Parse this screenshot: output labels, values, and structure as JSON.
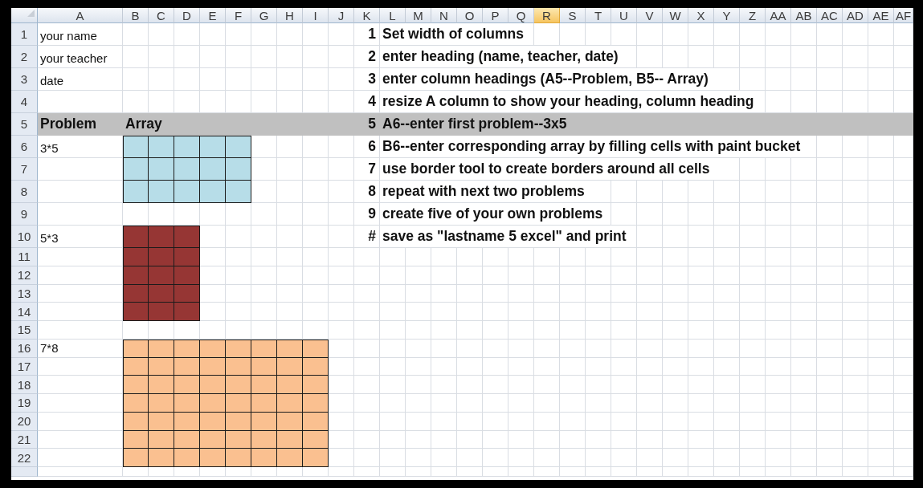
{
  "columns": [
    {
      "label": "A",
      "selected": false
    },
    {
      "label": "B",
      "selected": false
    },
    {
      "label": "C",
      "selected": false
    },
    {
      "label": "D",
      "selected": false
    },
    {
      "label": "E",
      "selected": false
    },
    {
      "label": "F",
      "selected": false
    },
    {
      "label": "G",
      "selected": false
    },
    {
      "label": "H",
      "selected": false
    },
    {
      "label": "I",
      "selected": false
    },
    {
      "label": "J",
      "selected": false
    },
    {
      "label": "K",
      "selected": false
    },
    {
      "label": "L",
      "selected": false
    },
    {
      "label": "M",
      "selected": false
    },
    {
      "label": "N",
      "selected": false
    },
    {
      "label": "O",
      "selected": false
    },
    {
      "label": "P",
      "selected": false
    },
    {
      "label": "Q",
      "selected": false
    },
    {
      "label": "R",
      "selected": true
    },
    {
      "label": "S",
      "selected": false
    },
    {
      "label": "T",
      "selected": false
    },
    {
      "label": "U",
      "selected": false
    },
    {
      "label": "V",
      "selected": false
    },
    {
      "label": "W",
      "selected": false
    },
    {
      "label": "X",
      "selected": false
    },
    {
      "label": "Y",
      "selected": false
    },
    {
      "label": "Z",
      "selected": false
    },
    {
      "label": "AA",
      "selected": false
    },
    {
      "label": "AB",
      "selected": false
    },
    {
      "label": "AC",
      "selected": false
    },
    {
      "label": "AD",
      "selected": false
    },
    {
      "label": "AE",
      "selected": false
    },
    {
      "label": "AF",
      "selected": false
    }
  ],
  "rows": [
    {
      "number": "1",
      "column_a": "your name",
      "column_k": "1",
      "column_l": "Set width of columns",
      "bold": false,
      "highlighted": false
    },
    {
      "number": "2",
      "column_a": "your teacher",
      "column_k": "2",
      "column_l": "enter heading (name, teacher, date)",
      "bold": false,
      "highlighted": false
    },
    {
      "number": "3",
      "column_a": "date",
      "column_k": "3",
      "column_l": "enter column headings (A5--Problem, B5-- Array)",
      "bold": false,
      "highlighted": false
    },
    {
      "number": "4",
      "column_k": "4",
      "column_l": "resize A column to show your heading, column heading",
      "highlighted": false
    },
    {
      "number": "5",
      "column_a": "Problem",
      "column_b": "Array",
      "column_k": "5",
      "column_l": "A6--enter first problem--3x5",
      "bold": true,
      "highlighted": true
    },
    {
      "number": "6",
      "column_a": "3*5",
      "column_k": "6",
      "column_l": "B6--enter corresponding array by filling cells with paint bucket",
      "bold": false,
      "highlighted": false,
      "fill": {
        "color": "#b7dde8",
        "cells": [
          true,
          true,
          true,
          true,
          true,
          false,
          false,
          false
        ]
      }
    },
    {
      "number": "7",
      "column_k": "7",
      "column_l": "use border tool to create borders around all cells",
      "highlighted": false,
      "fill": {
        "color": "#b7dde8",
        "cells": [
          true,
          true,
          true,
          true,
          true,
          false,
          false,
          false
        ]
      }
    },
    {
      "number": "8",
      "column_k": "8",
      "column_l": "repeat with next two problems",
      "highlighted": false,
      "fill": {
        "color": "#b7dde8",
        "cells": [
          true,
          true,
          true,
          true,
          true,
          false,
          false,
          false
        ]
      }
    },
    {
      "number": "9",
      "column_k": "9",
      "column_l": "create five of your own problems",
      "highlighted": false
    },
    {
      "number": "10",
      "column_a": "5*3",
      "column_k": "#",
      "column_l": "save as \"lastname 5 excel\" and print",
      "bold": false,
      "highlighted": false,
      "fill": {
        "color": "#963634",
        "cells": [
          true,
          true,
          true,
          false,
          false,
          false,
          false,
          false
        ]
      }
    },
    {
      "number": "11",
      "highlighted": false,
      "fill": {
        "color": "#963634",
        "cells": [
          true,
          true,
          true,
          false,
          false,
          false,
          false,
          false
        ]
      }
    },
    {
      "number": "12",
      "highlighted": false,
      "fill": {
        "color": "#963634",
        "cells": [
          true,
          true,
          true,
          false,
          false,
          false,
          false,
          false
        ]
      }
    },
    {
      "number": "13",
      "highlighted": false,
      "fill": {
        "color": "#963634",
        "cells": [
          true,
          true,
          true,
          false,
          false,
          false,
          false,
          false
        ]
      }
    },
    {
      "number": "14",
      "highlighted": false,
      "fill": {
        "color": "#963634",
        "cells": [
          true,
          true,
          true,
          false,
          false,
          false,
          false,
          false
        ]
      }
    },
    {
      "number": "15",
      "highlighted": false
    },
    {
      "number": "16",
      "column_a": "7*8",
      "bold": false,
      "highlighted": false,
      "fill": {
        "color": "#fac090",
        "cells": [
          true,
          true,
          true,
          true,
          true,
          true,
          true,
          true
        ]
      }
    },
    {
      "number": "17",
      "highlighted": false,
      "fill": {
        "color": "#fac090",
        "cells": [
          true,
          true,
          true,
          true,
          true,
          true,
          true,
          true
        ]
      }
    },
    {
      "number": "18",
      "highlighted": false,
      "fill": {
        "color": "#fac090",
        "cells": [
          true,
          true,
          true,
          true,
          true,
          true,
          true,
          true
        ]
      }
    },
    {
      "number": "19",
      "highlighted": false,
      "fill": {
        "color": "#fac090",
        "cells": [
          true,
          true,
          true,
          true,
          true,
          true,
          true,
          true
        ]
      }
    },
    {
      "number": "20",
      "highlighted": false,
      "fill": {
        "color": "#fac090",
        "cells": [
          true,
          true,
          true,
          true,
          true,
          true,
          true,
          true
        ]
      }
    },
    {
      "number": "21",
      "highlighted": false,
      "fill": {
        "color": "#fac090",
        "cells": [
          true,
          true,
          true,
          true,
          true,
          true,
          true,
          true
        ]
      }
    },
    {
      "number": "22",
      "highlighted": false,
      "fill": {
        "color": "#fac090",
        "cells": [
          true,
          true,
          true,
          true,
          true,
          true,
          true,
          true
        ]
      }
    }
  ]
}
